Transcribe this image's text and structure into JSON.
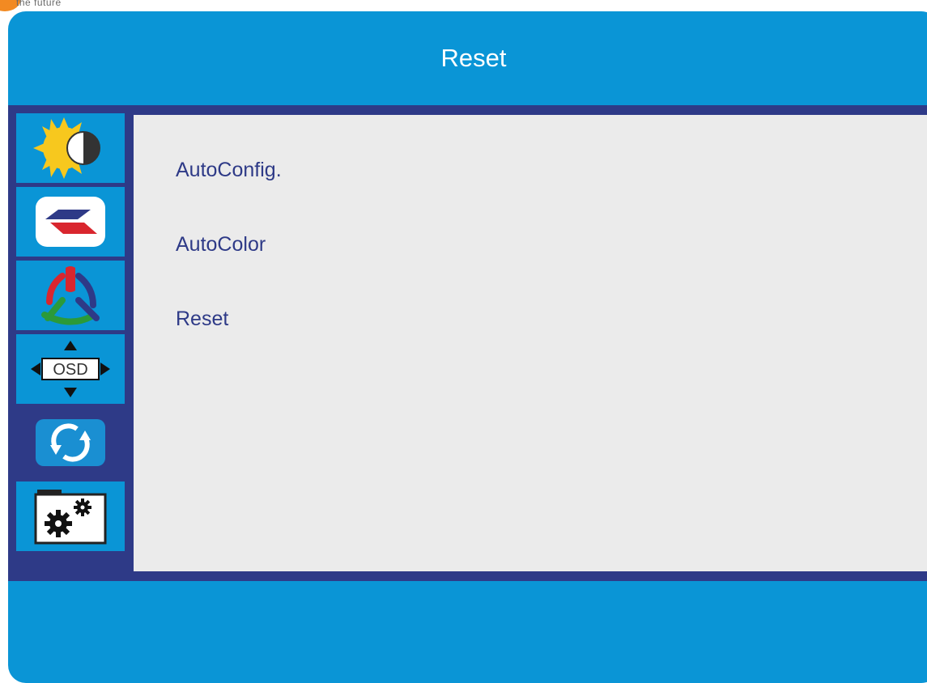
{
  "header": {
    "tagline": "the future"
  },
  "osd": {
    "title": "Reset",
    "sidebar": [
      {
        "name": "picture",
        "icon": "brightness-contrast-icon",
        "active": false
      },
      {
        "name": "image",
        "icon": "image-setup-icon",
        "active": false
      },
      {
        "name": "color",
        "icon": "color-temperature-icon",
        "active": false
      },
      {
        "name": "osd",
        "icon": "osd-position-icon",
        "label": "OSD",
        "active": false
      },
      {
        "name": "reset",
        "icon": "reset-icon",
        "active": true
      },
      {
        "name": "misc",
        "icon": "settings-gears-icon",
        "active": false
      }
    ],
    "menu": [
      {
        "label": "AutoConfig."
      },
      {
        "label": "AutoColor"
      },
      {
        "label": "Reset"
      }
    ]
  },
  "colors": {
    "background_blue": "#0a95d6",
    "frame_navy": "#2e3a87",
    "content_grey": "#ebebeb",
    "menu_text": "#2e3a87",
    "accent_orange": "#f28a22"
  }
}
